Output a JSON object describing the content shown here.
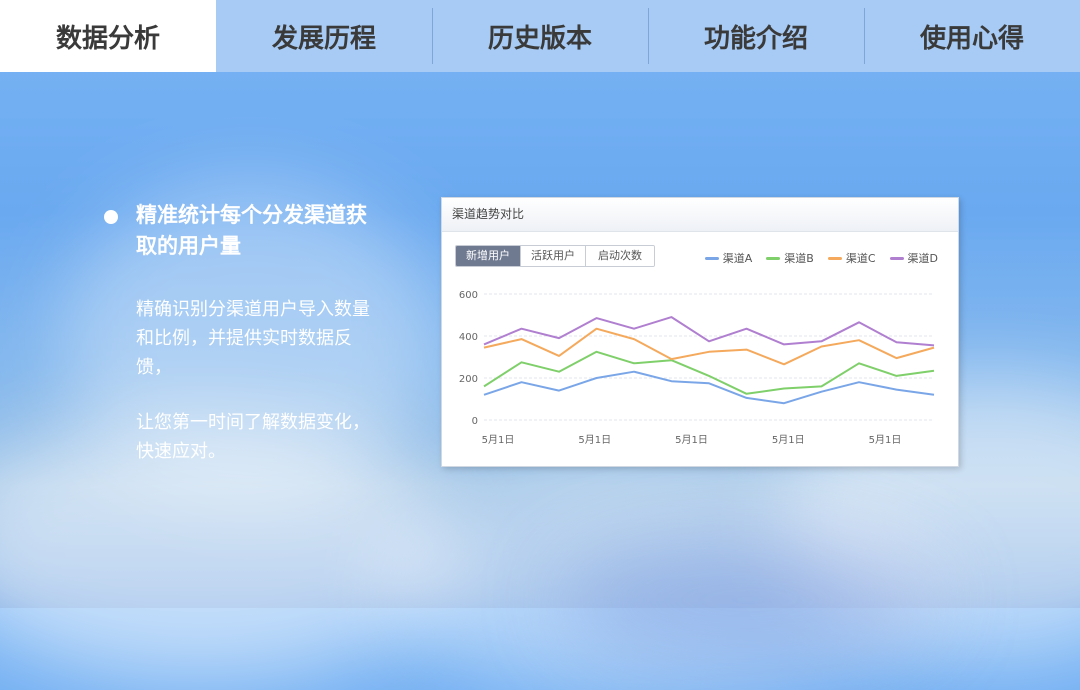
{
  "tabs": [
    {
      "label": "数据分析",
      "active": true
    },
    {
      "label": "发展历程",
      "active": false
    },
    {
      "label": "历史版本",
      "active": false
    },
    {
      "label": "功能介绍",
      "active": false
    },
    {
      "label": "使用心得",
      "active": false
    }
  ],
  "content": {
    "heading": "精准统计每个分发渠道获取的用户量",
    "paragraph1": "精确识别分渠道用户导入数量和比例，并提供实时数据反馈，",
    "paragraph2": "让您第一时间了解数据变化，快速应对。"
  },
  "card": {
    "title": "渠道趋势对比",
    "buttons": [
      "新增用户",
      "活跃用户",
      "启动次数"
    ],
    "active_button": 0
  },
  "chart_data": {
    "type": "line",
    "x": [
      "5月1日",
      "5月1日",
      "5月1日",
      "5月1日",
      "5月1日",
      "5月1日",
      "5月1日",
      "5月1日",
      "5月1日",
      "5月1日",
      "5月1日",
      "5月1日",
      "5月1日",
      "5月1日",
      "5月1日",
      "5月1日",
      "5月1日",
      "5月1日",
      "5月1日"
    ],
    "x_tick_labels": [
      "5月1日",
      "5月1日",
      "5月1日",
      "5月1日",
      "5月1日"
    ],
    "ylim": [
      0,
      600
    ],
    "yticks": [
      0,
      200,
      400,
      600
    ],
    "grid": true,
    "legend_position": "top-right",
    "series": [
      {
        "name": "渠道A",
        "color": "#7aa6e8",
        "values": [
          120,
          180,
          140,
          200,
          230,
          185,
          175,
          105,
          80,
          135,
          180,
          145,
          120
        ]
      },
      {
        "name": "渠道B",
        "color": "#7fcf6a",
        "values": [
          160,
          275,
          230,
          325,
          270,
          285,
          210,
          125,
          150,
          160,
          270,
          210,
          235
        ]
      },
      {
        "name": "渠道C",
        "color": "#f4a95c",
        "values": [
          345,
          385,
          305,
          435,
          385,
          290,
          325,
          335,
          265,
          350,
          380,
          295,
          345
        ]
      },
      {
        "name": "渠道D",
        "color": "#b07fd0",
        "values": [
          360,
          435,
          390,
          485,
          435,
          490,
          375,
          435,
          360,
          375,
          465,
          370,
          355
        ]
      }
    ]
  }
}
